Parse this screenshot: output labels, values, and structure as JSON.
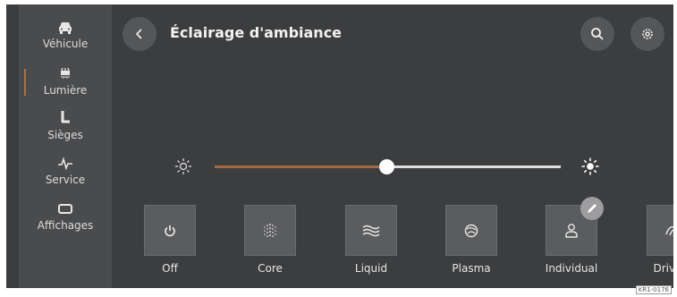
{
  "header": {
    "title": "Éclairage d'ambiance"
  },
  "sidebar": {
    "items": [
      {
        "label": "Véhicule",
        "icon": "car-icon"
      },
      {
        "label": "Lumière",
        "icon": "ambient-light-icon",
        "active": true
      },
      {
        "label": "Sièges",
        "icon": "seat-icon"
      },
      {
        "label": "Service",
        "icon": "pulse-icon"
      },
      {
        "label": "Affichages",
        "icon": "display-icon"
      }
    ]
  },
  "brightness": {
    "level": 0.5
  },
  "modes": [
    {
      "label": "Off",
      "icon": "power-icon"
    },
    {
      "label": "Core",
      "icon": "core-dots-icon"
    },
    {
      "label": "Liquid",
      "icon": "waves-icon"
    },
    {
      "label": "Plasma",
      "icon": "plasma-icon"
    },
    {
      "label": "Individual",
      "icon": "person-icon"
    },
    {
      "label": "Drive P",
      "icon": "drive-icon"
    }
  ],
  "colors": {
    "background": "#3c3d3f",
    "sidebar": "#4a4b4d",
    "accent": "#a36a45",
    "tile": "#5b5c5e"
  },
  "reference_code": "KR1-0176"
}
